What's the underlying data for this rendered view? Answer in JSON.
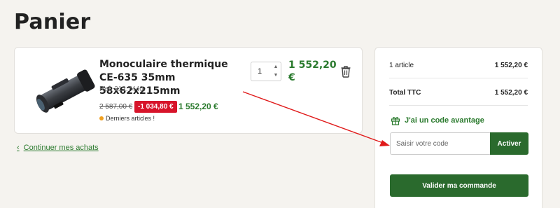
{
  "page": {
    "title": "Panier"
  },
  "cart_item": {
    "name": "Monoculaire thermique CE-635 35mm 58x62x215mm",
    "ref": "Ref: 312.7440.",
    "old_price": "2 587,00 €",
    "discount": "-1 034,80 €",
    "price": "1 552,20 €",
    "stock_note": "Derniers articles !",
    "quantity": "1",
    "line_total": "1 552,20 €",
    "image_icon": "thermal-monocular-image",
    "delete_icon": "trash-icon"
  },
  "continue_link": {
    "label": "Continuer mes achats",
    "icon": "chevron-left-icon"
  },
  "summary": {
    "items_label": "1 article",
    "items_value": "1 552,20 €",
    "total_label": "Total TTC",
    "total_value": "1 552,20 €",
    "voucher_title": "J'ai un code avantage",
    "voucher_icon": "gift-icon",
    "voucher_placeholder": "Saisir votre code",
    "voucher_button": "Activer",
    "checkout_button": "Valider ma commande"
  },
  "colors": {
    "accent_green": "#2a7a2d",
    "button_green": "#2a6a2d",
    "discount_red": "#d7142a",
    "annotation_arrow": "#e01a1a"
  }
}
